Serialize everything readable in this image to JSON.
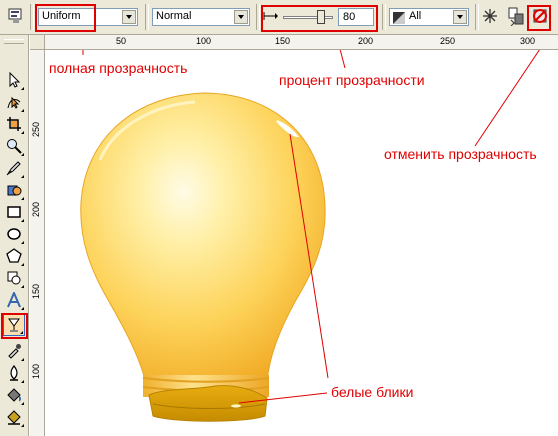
{
  "property_bar": {
    "icon": "transparency-properties-icon",
    "type_value": "Uniform",
    "operation_value": "Normal",
    "slider_percent": 0.8,
    "transparency_value": "80",
    "target_value": "All",
    "freeze_icon": "freeze-icon",
    "copy_icon": "copy-transparency-icon",
    "clear_icon": "clear-transparency-icon"
  },
  "ruler": {
    "h_labels": [
      "50",
      "100",
      "150",
      "200",
      "250",
      "300"
    ],
    "v_labels": [
      "250",
      "200",
      "150",
      "100"
    ]
  },
  "toolbox": {
    "tools": [
      "pick-tool-icon",
      "shape-tool-icon",
      "crop-tool-icon",
      "zoom-tool-icon",
      "freehand-tool-icon",
      "smart-fill-tool-icon",
      "rectangle-tool-icon",
      "ellipse-tool-icon",
      "polygon-tool-icon",
      "text-tool-icon",
      "interactive-transparency-tool-icon",
      "eyedropper-tool-icon",
      "outline-tool-icon",
      "fill-tool-icon",
      "interactive-fill-tool-icon"
    ]
  },
  "annotations": {
    "full_transparency": "полная прозрачность",
    "transparency_percent": "процент прозрачности",
    "cancel_transparency": "отменить прозрачность",
    "white_highlights": "белые блики"
  },
  "colors": {
    "annotation_red": "#e00000",
    "bulb_yellow": "#fdd35a",
    "bulb_base": "#d9a000"
  }
}
